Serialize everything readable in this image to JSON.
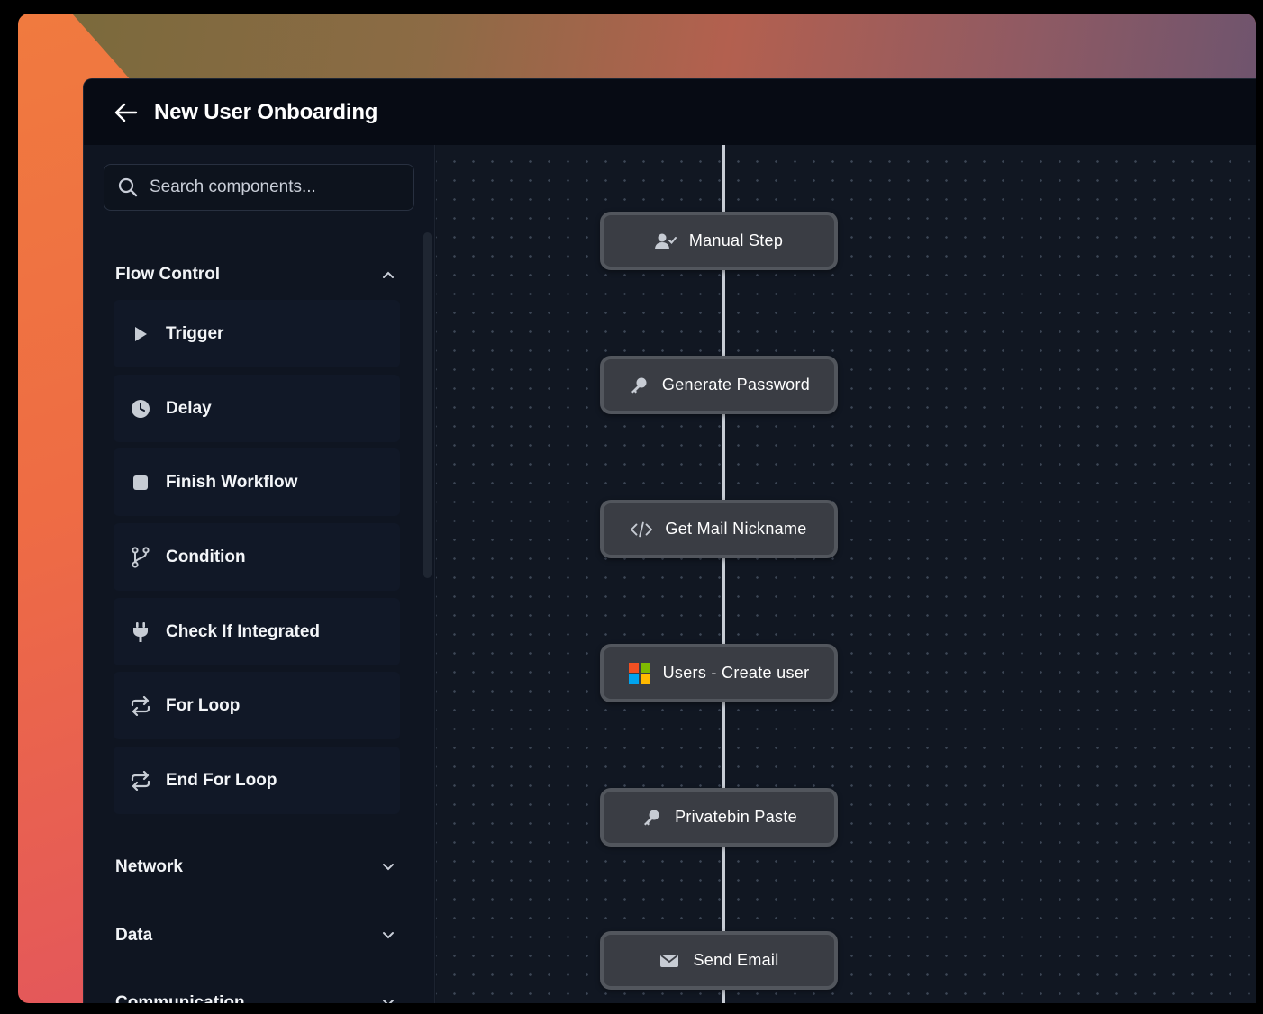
{
  "window": {
    "title": "New User Onboarding"
  },
  "search": {
    "placeholder": "Search components..."
  },
  "sidebar": {
    "sections": [
      {
        "label": "Flow Control",
        "expanded": true,
        "items": [
          {
            "label": "Trigger",
            "icon": "play-icon"
          },
          {
            "label": "Delay",
            "icon": "clock-icon"
          },
          {
            "label": "Finish Workflow",
            "icon": "stop-icon"
          },
          {
            "label": "Condition",
            "icon": "branch-icon"
          },
          {
            "label": "Check If Integrated",
            "icon": "plug-icon"
          },
          {
            "label": "For Loop",
            "icon": "repeat-icon"
          },
          {
            "label": "End For Loop",
            "icon": "repeat-icon"
          }
        ]
      },
      {
        "label": "Network",
        "expanded": false
      },
      {
        "label": "Data",
        "expanded": false
      },
      {
        "label": "Communication",
        "expanded": false
      }
    ]
  },
  "flow": {
    "nodes": [
      {
        "label": "Manual Step",
        "icon": "user-check-icon"
      },
      {
        "label": "Generate Password",
        "icon": "key-icon"
      },
      {
        "label": "Get Mail Nickname",
        "icon": "code-icon"
      },
      {
        "label": "Users - Create user",
        "icon": "microsoft-logo-icon"
      },
      {
        "label": "Privatebin Paste",
        "icon": "key-icon"
      },
      {
        "label": "Send Email",
        "icon": "envelope-icon"
      }
    ]
  },
  "colors": {
    "app_bg": "#0f1520",
    "topbar_bg": "#070b14",
    "node_bg": "#3a3d44",
    "node_border": "#52565d",
    "connector": "#c7ccd4"
  }
}
